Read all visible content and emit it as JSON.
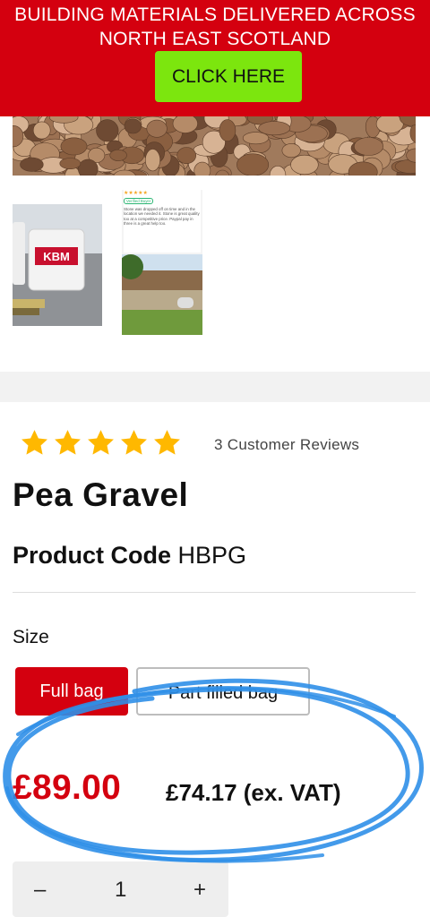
{
  "banner": {
    "line1": "BUILDING MATERIALS DELIVERED ACROSS",
    "line2": "NORTH EAST SCOTLAND",
    "cta_label": "CLICK HERE",
    "color": "#d4000f",
    "cta_color": "#7ce60e"
  },
  "gallery": {
    "bag_brand": "KBM",
    "review_snippet": {
      "stars": "★★★★★",
      "badge": "Verified Buyer",
      "text": "Stone was dropped off on time and in the location we needed it. Stone is great quality too at a competitive price. Paypal pay in three is a great help too."
    }
  },
  "product": {
    "rating": 5,
    "review_count_text": "3 Customer Reviews",
    "title": "Pea Gravel",
    "code_label": "Product Code",
    "code_value": "HBPG",
    "size_label": "Size",
    "size_options": [
      "Full bag",
      "Part filled bag"
    ],
    "selected_size": "Full bag",
    "price": "£89.00",
    "price_ex_vat": "£74.17 (ex. VAT)",
    "quantity": "1",
    "qty_minus": "–",
    "qty_plus": "+",
    "accent_color": "#d4000f",
    "star_color": "#ffb800",
    "annotation_color": "#2f8fe8"
  }
}
